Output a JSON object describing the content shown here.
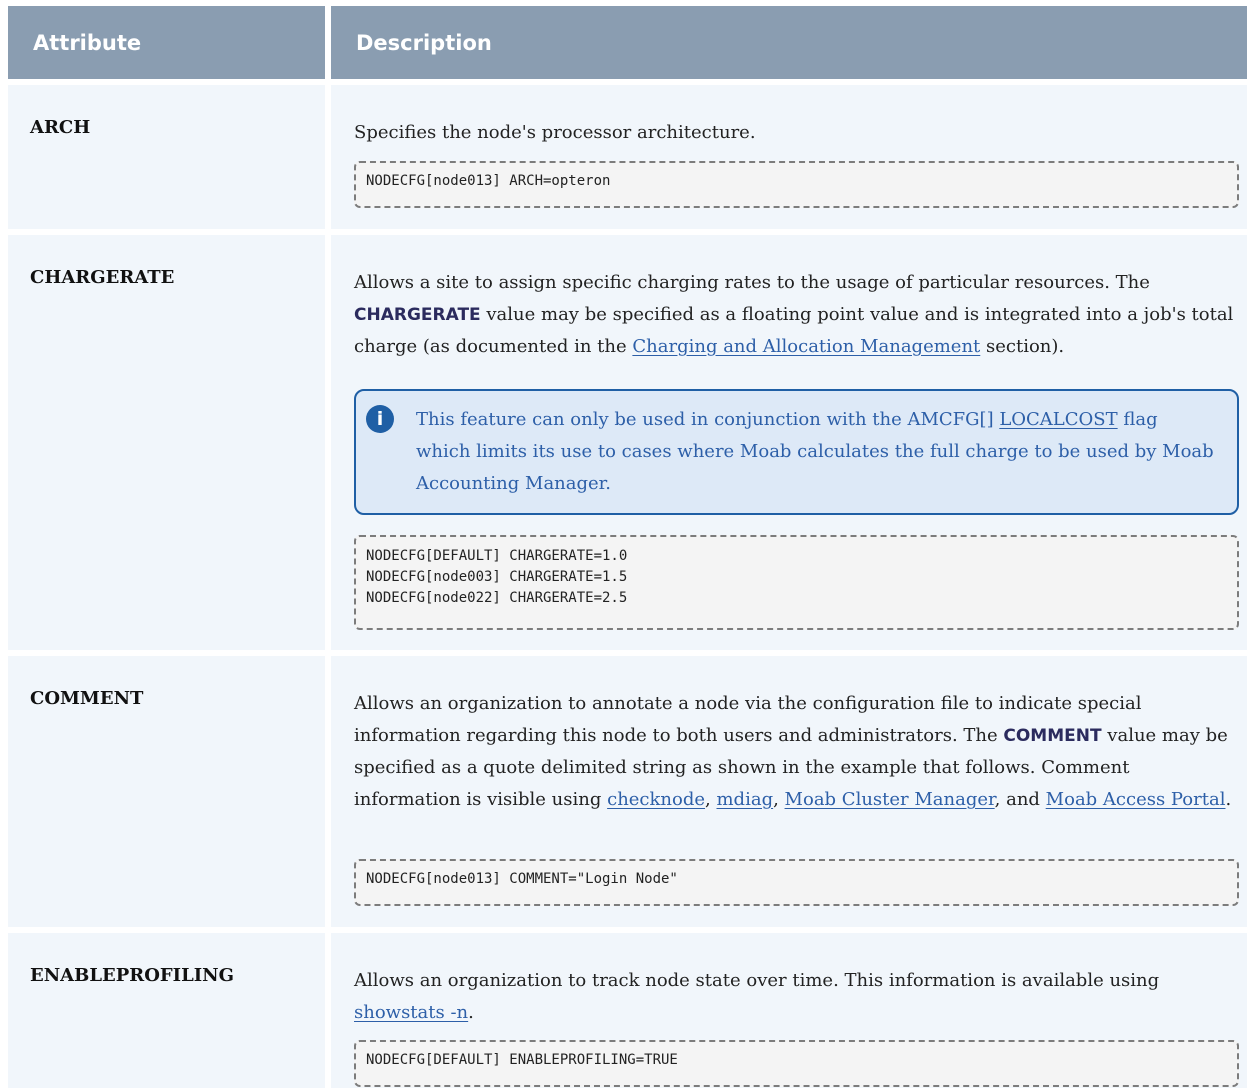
{
  "header": {
    "attribute": "Attribute",
    "description": "Description"
  },
  "rows": [
    {
      "name": "ARCH",
      "desc": "Specifies the node's processor architecture.",
      "code": "NODECFG[node013] ARCH=opteron"
    },
    {
      "name": "CHARGERATE",
      "desc_a": "Allows a site to assign specific charging rates to the usage of particular resources. The ",
      "desc_bold": "CHARGERATE",
      "desc_b": " value may be specified as a floating point value and is integrated into a job's total charge (as documented in the ",
      "desc_link": "Charging and Allocation Management",
      "desc_c": " section).",
      "note_a": "This feature can only be used in conjunction with the AMCFG[] ",
      "note_link": "LOCALCOST",
      "note_b": " flag which limits its use to cases where Moab calculates the full charge to be used by Moab Accounting Manager.",
      "code": "NODECFG[DEFAULT] CHARGERATE=1.0\nNODECFG[node003] CHARGERATE=1.5\nNODECFG[node022] CHARGERATE=2.5"
    },
    {
      "name": "COMMENT",
      "desc_a": "Allows an organization to annotate a node via the configuration file to indicate special information regarding this node to both users and administrators. The ",
      "desc_bold": "COMMENT",
      "desc_b": " value may be specified as a quote delimited string as shown in the example that follows. Comment information is visible using ",
      "link1": "checknode",
      "sep1": ", ",
      "link2": "mdiag",
      "sep2": ", ",
      "link3": "Moab Cluster Manager",
      "sep3": ", and ",
      "link4": "Moab Access Portal",
      "end": ".",
      "code": "NODECFG[node013] COMMENT=\"Login Node\""
    },
    {
      "name": "ENABLEPROFILING",
      "desc_a": "Allows an organization to track node state over time. This information is available using ",
      "desc_link": "showstats -n",
      "desc_b": ".",
      "code": "NODECFG[DEFAULT] ENABLEPROFILING=TRUE"
    }
  ],
  "colors": {
    "header_bg": "#8a9db1",
    "row_bg": "#f1f6fb",
    "link": "#2d5fa8",
    "note_bg": "#dde9f7",
    "note_border": "#1f5fa5"
  },
  "icons": {
    "note": "info-icon"
  }
}
